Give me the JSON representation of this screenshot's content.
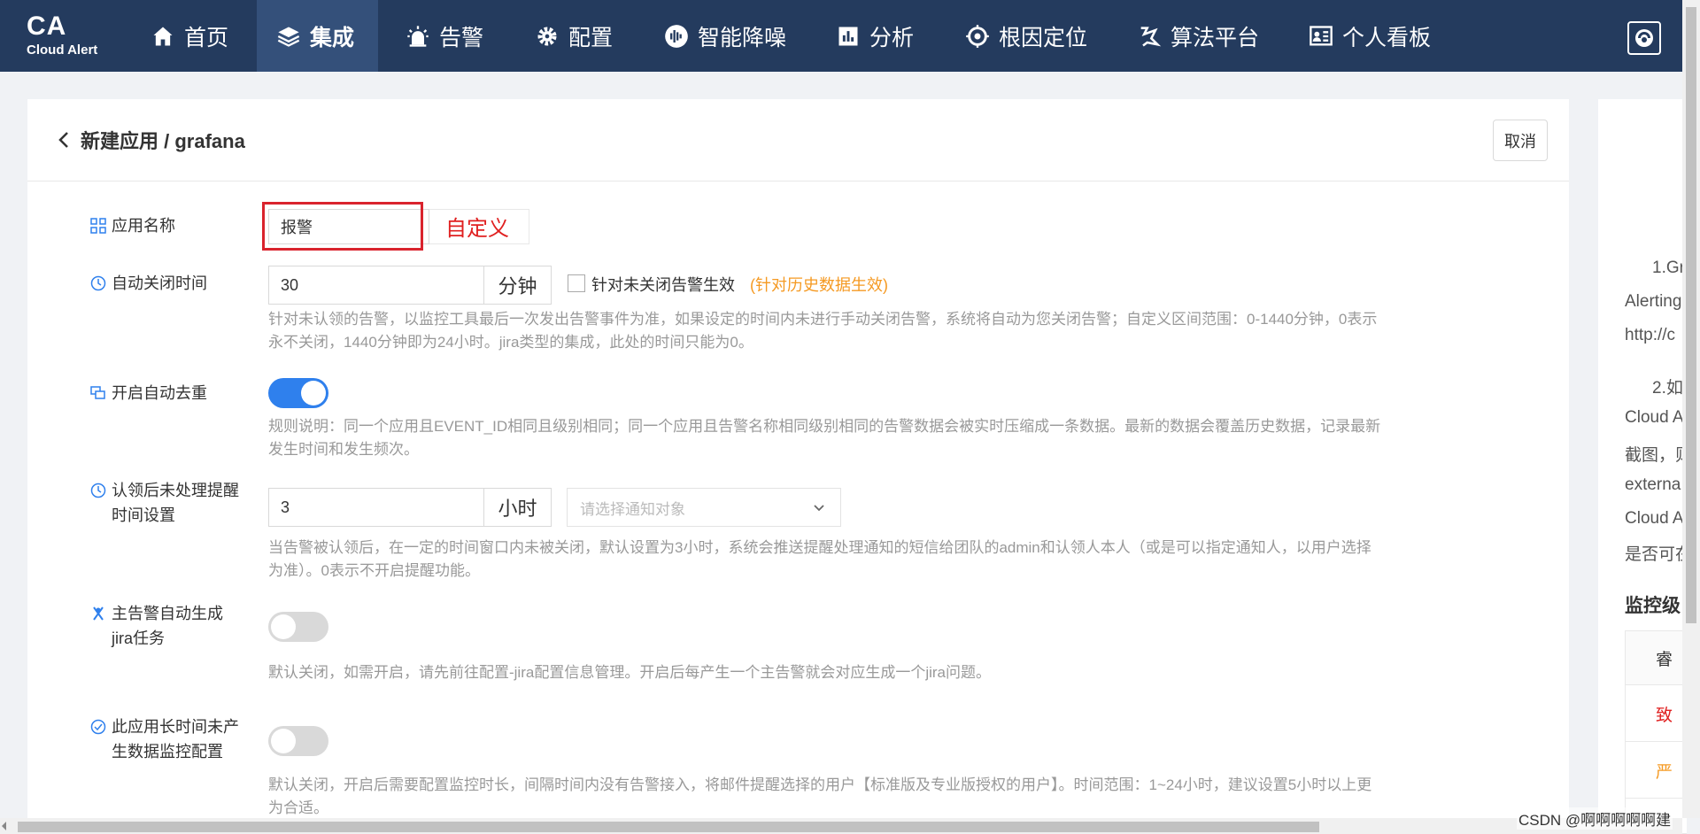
{
  "brand": {
    "logo": "CA",
    "name": "Cloud Alert"
  },
  "nav": [
    {
      "label": "首页",
      "icon": "home-icon"
    },
    {
      "label": "集成",
      "icon": "layers-icon",
      "active": true
    },
    {
      "label": "告警",
      "icon": "alarm-icon"
    },
    {
      "label": "配置",
      "icon": "gear-icon"
    },
    {
      "label": "智能降噪",
      "icon": "sound-wave-icon"
    },
    {
      "label": "分析",
      "icon": "bar-chart-icon"
    },
    {
      "label": "根因定位",
      "icon": "target-icon"
    },
    {
      "label": "算法平台",
      "icon": "algorithm-icon"
    },
    {
      "label": "个人看板",
      "icon": "dashboard-icon"
    }
  ],
  "header": {
    "title": "新建应用 / grafana",
    "cancel": "取消"
  },
  "form": {
    "app_name": {
      "label": "应用名称",
      "value": "报警",
      "annotation": "自定义"
    },
    "auto_close": {
      "label": "自动关闭时间",
      "value": "30",
      "unit": "分钟",
      "checkbox_label": "针对未关闭告警生效",
      "checkbox_hint": "(针对历史数据生效)",
      "checked": false,
      "help_line1": "针对未认领的告警，以监控工具最后一次发出告警事件为准，如果设定的时间内未进行手动关闭告警，系统将自动为您关闭告警；自定义区间范围：0-1440分钟，0表示",
      "help_line2": "永不关闭，1440分钟即为24小时。jira类型的集成，此处的时间只能为0。"
    },
    "dedup": {
      "label": "开启自动去重",
      "enabled": true,
      "help_line1": "规则说明：同一个应用且EVENT_ID相同且级别相同；同一个应用且告警名称相同级别相同的告警数据会被实时压缩成一条数据。最新的数据会覆盖历史数据，记录最新",
      "help_line2": "发生时间和发生频次。"
    },
    "reminder": {
      "label_line1": "认领后未处理提醒",
      "label_line2": "时间设置",
      "value": "3",
      "unit": "小时",
      "select_placeholder": "请选择通知对象",
      "help_line1": "当告警被认领后，在一定的时间窗口内未被关闭，默认设置为3小时，系统会推送提醒处理通知的短信给团队的admin和认领人本人（或是可以指定通知人，以用户选择",
      "help_line2": "为准）。0表示不开启提醒功能。"
    },
    "jira": {
      "label_line1": "主告警自动生成",
      "label_line2": "jira任务",
      "enabled": false,
      "help": "默认关闭，如需开启，请先前往配置-jira配置信息管理。开启后每产生一个主告警就会对应生成一个jira问题。"
    },
    "no_data": {
      "label_line1": "此应用长时间未产",
      "label_line2": "生数据监控配置",
      "enabled": false,
      "help_line1": "默认关闭，开启后需要配置监控时长，间隔时间内没有告警接入，将邮件提醒选择的用户【标准版及专业版授权的用户】。时间范围：1~24小时，建议设置5小时以上更",
      "help_line2": "为合适。"
    }
  },
  "side": {
    "lines": [
      "1.Gr",
      "Alerting",
      "http://c",
      "2.如",
      "Cloud A",
      "截图，则",
      "externa",
      "Cloud A",
      "是否可在"
    ],
    "section_title": "监控级",
    "table_header": "睿",
    "rows": [
      {
        "text": "致",
        "color": "#e02020"
      },
      {
        "text": "严",
        "color": "#f59a23"
      }
    ]
  },
  "watermark": "CSDN @啊啊啊啊啊建",
  "colors": {
    "nav_bg": "#243b5e",
    "nav_active": "#34507a",
    "toggle_on": "#2f80ed",
    "annotation_red": "#e02020",
    "hint_orange": "#f59a23"
  }
}
